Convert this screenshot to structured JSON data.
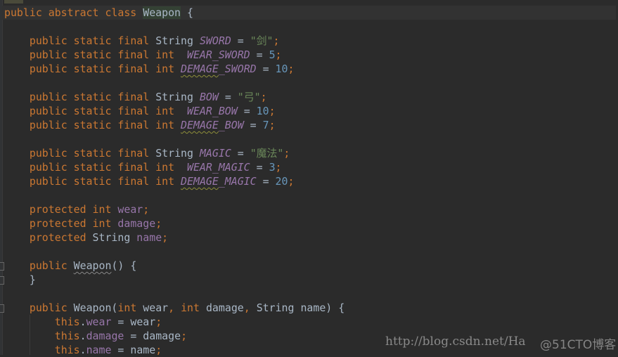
{
  "colors": {
    "background": "#2b2b2b",
    "keyword": "#cc7832",
    "text": "#a9b7c6",
    "constant": "#9876aa",
    "number": "#6897bb",
    "string": "#6a8759"
  },
  "code": [
    [
      [
        "k",
        "public abstract class "
      ],
      [
        "t hl",
        "Weapon"
      ],
      [
        "t",
        " {"
      ]
    ],
    [],
    [
      [
        "t",
        "    "
      ],
      [
        "k",
        "public static final "
      ],
      [
        "t",
        "String "
      ],
      [
        "c",
        "SWORD"
      ],
      [
        "t",
        " = "
      ],
      [
        "s",
        "\"剑\""
      ],
      [
        "k",
        ";"
      ]
    ],
    [
      [
        "t",
        "    "
      ],
      [
        "k",
        "public static final int  "
      ],
      [
        "c",
        "WEAR_SWORD"
      ],
      [
        "t",
        " = "
      ],
      [
        "n",
        "5"
      ],
      [
        "k",
        ";"
      ]
    ],
    [
      [
        "t",
        "    "
      ],
      [
        "k",
        "public static final int "
      ],
      [
        "c w",
        "DEMAGE"
      ],
      [
        "c",
        "_SWORD"
      ],
      [
        "t",
        " = "
      ],
      [
        "n",
        "10"
      ],
      [
        "k",
        ";"
      ]
    ],
    [],
    [
      [
        "t",
        "    "
      ],
      [
        "k",
        "public static final "
      ],
      [
        "t",
        "String "
      ],
      [
        "c",
        "BOW"
      ],
      [
        "t",
        " = "
      ],
      [
        "s",
        "\"弓\""
      ],
      [
        "k",
        ";"
      ]
    ],
    [
      [
        "t",
        "    "
      ],
      [
        "k",
        "public static final int  "
      ],
      [
        "c",
        "WEAR_BOW"
      ],
      [
        "t",
        " = "
      ],
      [
        "n",
        "10"
      ],
      [
        "k",
        ";"
      ]
    ],
    [
      [
        "t",
        "    "
      ],
      [
        "k",
        "public static final int "
      ],
      [
        "c w",
        "DEMAGE"
      ],
      [
        "c",
        "_BOW"
      ],
      [
        "t",
        " = "
      ],
      [
        "n",
        "7"
      ],
      [
        "k",
        ";"
      ]
    ],
    [],
    [
      [
        "t",
        "    "
      ],
      [
        "k",
        "public static final "
      ],
      [
        "t",
        "String "
      ],
      [
        "c",
        "MAGIC"
      ],
      [
        "t",
        " = "
      ],
      [
        "s",
        "\"魔法\""
      ],
      [
        "k",
        ";"
      ]
    ],
    [
      [
        "t",
        "    "
      ],
      [
        "k",
        "public static final int  "
      ],
      [
        "c",
        "WEAR_MAGIC"
      ],
      [
        "t",
        " = "
      ],
      [
        "n",
        "3"
      ],
      [
        "k",
        ";"
      ]
    ],
    [
      [
        "t",
        "    "
      ],
      [
        "k",
        "public static final int "
      ],
      [
        "c w",
        "DEMAGE"
      ],
      [
        "c",
        "_MAGIC"
      ],
      [
        "t",
        " = "
      ],
      [
        "n",
        "20"
      ],
      [
        "k",
        ";"
      ]
    ],
    [],
    [
      [
        "t",
        "    "
      ],
      [
        "k",
        "protected int "
      ],
      [
        "f",
        "wear"
      ],
      [
        "k",
        ";"
      ]
    ],
    [
      [
        "t",
        "    "
      ],
      [
        "k",
        "protected int "
      ],
      [
        "f",
        "damage"
      ],
      [
        "k",
        ";"
      ]
    ],
    [
      [
        "t",
        "    "
      ],
      [
        "k",
        "protected "
      ],
      [
        "t",
        "String "
      ],
      [
        "f",
        "name"
      ],
      [
        "k",
        ";"
      ]
    ],
    [],
    [
      [
        "t",
        "    "
      ],
      [
        "k",
        "public "
      ],
      [
        "t wg",
        "Weapon"
      ],
      [
        "t",
        "() {"
      ]
    ],
    [
      [
        "t",
        "    }"
      ]
    ],
    [],
    [
      [
        "t",
        "    "
      ],
      [
        "k",
        "public "
      ],
      [
        "t",
        "Weapon("
      ],
      [
        "k",
        "int "
      ],
      [
        "t",
        "wear"
      ],
      [
        "k",
        ", int "
      ],
      [
        "t",
        "damage"
      ],
      [
        "k",
        ", "
      ],
      [
        "t",
        "String name) {"
      ]
    ],
    [
      [
        "t",
        "        "
      ],
      [
        "k",
        "this"
      ],
      [
        "t",
        "."
      ],
      [
        "f",
        "wear"
      ],
      [
        "t",
        " = wear"
      ],
      [
        "k",
        ";"
      ]
    ],
    [
      [
        "t",
        "        "
      ],
      [
        "k",
        "this"
      ],
      [
        "t",
        "."
      ],
      [
        "f",
        "damage"
      ],
      [
        "t",
        " = damage"
      ],
      [
        "k",
        ";"
      ]
    ],
    [
      [
        "t",
        "        "
      ],
      [
        "k",
        "this"
      ],
      [
        "t",
        "."
      ],
      [
        "f",
        "name"
      ],
      [
        "t",
        " = name"
      ],
      [
        "k",
        ";"
      ]
    ]
  ],
  "watermark": {
    "text": "http://blog.csdn.net/Ha",
    "overlay": "@51CTO博客"
  }
}
